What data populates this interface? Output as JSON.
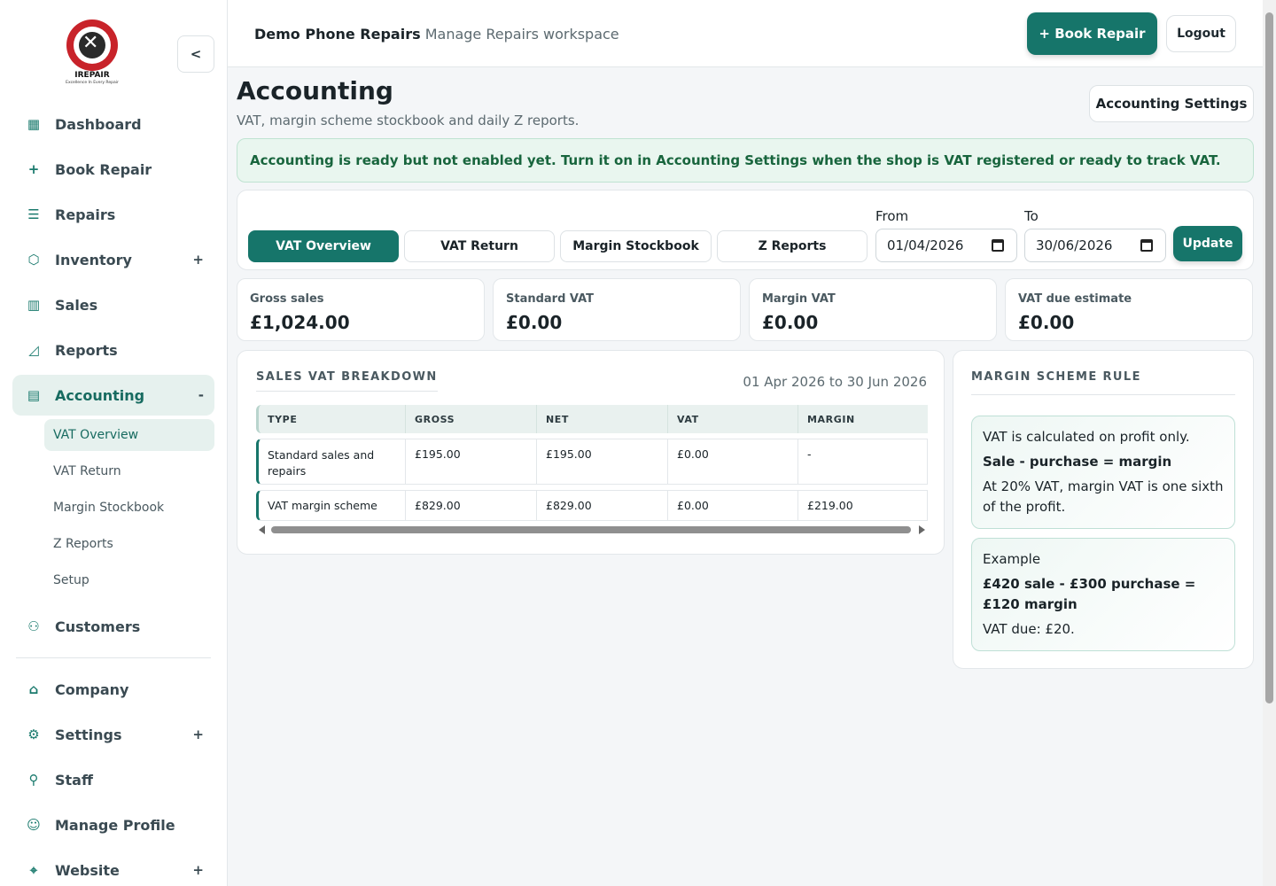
{
  "brand": {
    "logo_name": "IREPAIR",
    "logo_tagline": "Excellence In Every Repair",
    "shop_name": "Demo Phone Repairs",
    "workspace": "Manage Repairs workspace"
  },
  "sidebar": {
    "collapse_label": "<",
    "items": [
      {
        "label": "Dashboard",
        "icon": "dashboard-icon"
      },
      {
        "label": "Book Repair",
        "icon": "plus-icon"
      },
      {
        "label": "Repairs",
        "icon": "list-icon"
      },
      {
        "label": "Inventory",
        "icon": "box-icon",
        "expand": "+"
      },
      {
        "label": "Sales",
        "icon": "bar-chart-icon"
      },
      {
        "label": "Reports",
        "icon": "line-chart-icon"
      },
      {
        "label": "Accounting",
        "icon": "ledger-icon",
        "expand": "-"
      },
      {
        "label": "Customers",
        "icon": "users-icon"
      },
      {
        "label": "Company",
        "icon": "bank-icon"
      },
      {
        "label": "Settings",
        "icon": "gear-icon",
        "expand": "+"
      },
      {
        "label": "Staff",
        "icon": "user-plus-icon"
      },
      {
        "label": "Manage Profile",
        "icon": "user-icon"
      },
      {
        "label": "Website",
        "icon": "globe-icon",
        "expand": "+"
      }
    ],
    "accounting_sub": [
      {
        "label": "VAT Overview"
      },
      {
        "label": "VAT Return"
      },
      {
        "label": "Margin Stockbook"
      },
      {
        "label": "Z Reports"
      },
      {
        "label": "Setup"
      }
    ]
  },
  "topbar": {
    "book_repair_label": "+ Book Repair",
    "logout_label": "Logout"
  },
  "page": {
    "title": "Accounting",
    "subtitle": "VAT, margin scheme stockbook and daily Z reports.",
    "settings_button": "Accounting Settings",
    "alert": "Accounting is ready but not enabled yet. Turn it on in Accounting Settings when the shop is VAT registered or ready to track VAT."
  },
  "filters": {
    "tabs": [
      "VAT Overview",
      "VAT Return",
      "Margin Stockbook",
      "Z Reports"
    ],
    "from_label": "From",
    "from_value": "01/04/2026",
    "to_label": "To",
    "to_value": "30/06/2026",
    "update_label": "Update"
  },
  "stats": [
    {
      "label": "Gross sales",
      "value": "£1,024.00"
    },
    {
      "label": "Standard VAT",
      "value": "£0.00"
    },
    {
      "label": "Margin VAT",
      "value": "£0.00"
    },
    {
      "label": "VAT due estimate",
      "value": "£0.00"
    }
  ],
  "breakdown": {
    "title": "SALES VAT BREAKDOWN",
    "range": "01 Apr 2026 to 30 Jun 2026",
    "columns": [
      "TYPE",
      "GROSS",
      "NET",
      "VAT",
      "MARGIN"
    ],
    "rows": [
      [
        "Standard sales and repairs",
        "£195.00",
        "£195.00",
        "£0.00",
        "-"
      ],
      [
        "VAT margin scheme",
        "£829.00",
        "£829.00",
        "£0.00",
        "£219.00"
      ]
    ]
  },
  "margin_rule": {
    "title": "MARGIN SCHEME RULE",
    "line1": "VAT is calculated on profit only.",
    "line2": "Sale - purchase = margin",
    "line3": "At 20% VAT, margin VAT is one sixth of the profit.",
    "example_label": "Example",
    "example_formula": "£420 sale - £300 purchase = £120 margin",
    "example_result": "VAT due: £20."
  },
  "colors": {
    "accent": "#16756a",
    "active_bg": "#e6f1ee",
    "alert_bg": "#e9f6ef",
    "alert_text": "#18653d"
  }
}
